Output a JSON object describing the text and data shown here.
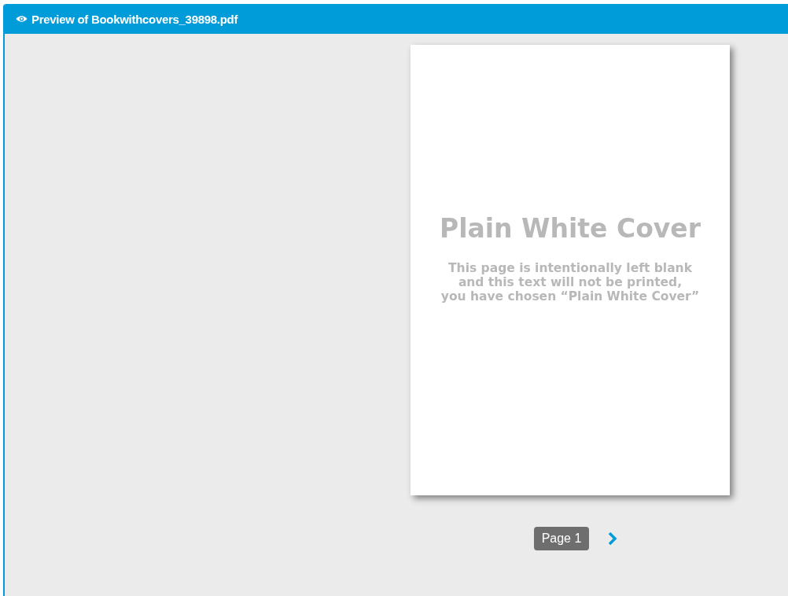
{
  "window": {
    "title": "Preview of Bookwithcovers_39898.pdf"
  },
  "page": {
    "heading": "Plain White Cover",
    "note_lines": [
      "This page is intentionally left blank",
      "and this text will not be printed,",
      "you have chosen “Plain White Cover”"
    ]
  },
  "pager": {
    "label": "Page 1"
  }
}
